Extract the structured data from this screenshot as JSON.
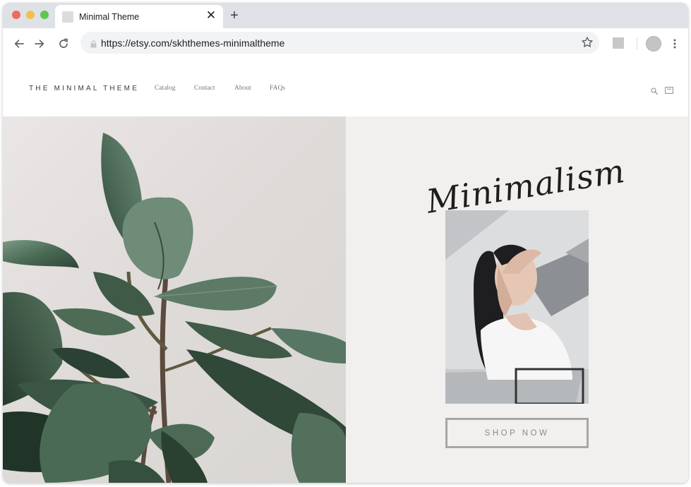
{
  "browser": {
    "tab_title": "Minimal Theme",
    "tab_close_glyph": "✕",
    "new_tab_glyph": "+",
    "url": "https://etsy.com/skhthemes-minimaltheme",
    "icons": [
      "back-arrow-icon",
      "forward-arrow-icon",
      "reload-icon",
      "lock-icon",
      "star-icon",
      "extension-icon",
      "profile-avatar",
      "menu-kebab-icon"
    ]
  },
  "site": {
    "logo": "THE MINIMAL THEME",
    "nav": [
      "Catalog",
      "Contact",
      "About",
      "FAQs"
    ],
    "header_icons": [
      "search-icon",
      "cart-icon"
    ]
  },
  "hero": {
    "script_heading": "Minimalism",
    "button_label": "SHOP NOW",
    "left_image": "rubber plant leaves",
    "portrait_image": "woman in white shirt shading eyes"
  },
  "colors": {
    "tabstrip": "#dee1e6",
    "omnibox": "#f1f3f4",
    "hero_right_bg": "#f2f0ee",
    "leaf_green": "#3f5a47",
    "button_border": "#a8a7a2"
  }
}
